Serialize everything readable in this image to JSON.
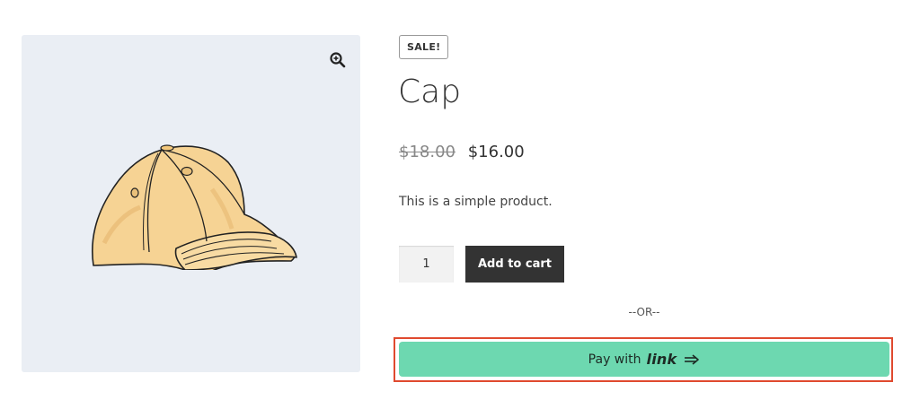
{
  "product": {
    "badge": "SALE!",
    "title": "Cap",
    "price_old": "$18.00",
    "price_new": "$16.00",
    "description": "This is a simple product.",
    "image_icon": "cap-illustration"
  },
  "gallery": {
    "zoom_icon": "zoom-in-icon"
  },
  "cart": {
    "quantity": "1",
    "add_label": "Add to cart"
  },
  "checkout": {
    "separator": "--OR--",
    "pay_prefix": "Pay with",
    "pay_brand": "link",
    "arrow_icon": "double-arrow-right-icon",
    "button_color": "#6dd8b0",
    "highlight_color": "#e04a2f"
  }
}
